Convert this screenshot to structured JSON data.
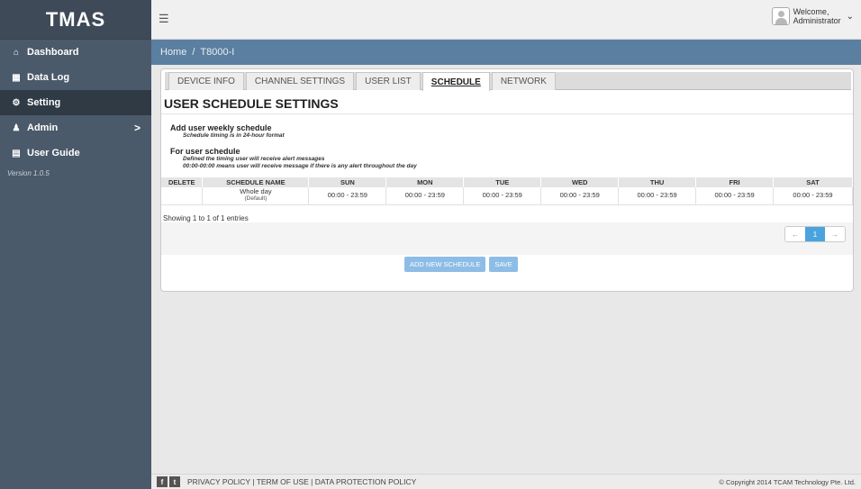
{
  "app": {
    "logo": "TMAS"
  },
  "sidebar": {
    "items": [
      {
        "label": "Dashboard",
        "icon": "home-icon"
      },
      {
        "label": "Data Log",
        "icon": "table-icon"
      },
      {
        "label": "Setting",
        "icon": "gear-icon",
        "active": true
      },
      {
        "label": "Admin",
        "icon": "user-icon",
        "chevron": ">"
      },
      {
        "label": "User Guide",
        "icon": "document-icon"
      }
    ],
    "version": "Version 1.0.5"
  },
  "header": {
    "welcome_line1": "Welcome,",
    "welcome_line2": "Administrator"
  },
  "breadcrumb": {
    "home": "Home",
    "separator": "/",
    "current": "T8000-I"
  },
  "tabs": [
    "DEVICE INFO",
    "CHANNEL SETTINGS",
    "USER LIST",
    "SCHEDULE",
    "NETWORK"
  ],
  "active_tab": "SCHEDULE",
  "page": {
    "title": "USER SCHEDULE SETTINGS",
    "add_heading": "Add user weekly schedule",
    "add_note": "Schedule timing is in 24-hour format",
    "for_heading": "For user schedule",
    "for_note1": "Defined the timing user will receive alert messages",
    "for_note2": "00:00-00:00 means user will receive message if there is any alert throughout the day"
  },
  "table": {
    "headers": [
      "DELETE",
      "SCHEDULE NAME",
      "SUN",
      "MON",
      "TUE",
      "WED",
      "THU",
      "FRI",
      "SAT"
    ],
    "rows": [
      {
        "delete": "",
        "name": "Whole day",
        "name_sub": "(Default)",
        "days": [
          "00:00 - 23:59",
          "00:00 - 23:59",
          "00:00 - 23:59",
          "00:00 - 23:59",
          "00:00 - 23:59",
          "00:00 - 23:59",
          "00:00 - 23:59"
        ]
      }
    ],
    "entries_text": "Showing 1 to 1 of 1 entries"
  },
  "pager": {
    "prev": "←",
    "current": "1",
    "next": "→"
  },
  "buttons": {
    "add": "ADD NEW SCHEDULE",
    "save": "SAVE"
  },
  "footer": {
    "social": [
      "f",
      "t"
    ],
    "links": "PRIVACY POLICY | TERM OF USE | DATA PROTECTION POLICY",
    "copyright": "© Copyright 2014 TCAM Technology Pte. Ltd."
  },
  "colors": {
    "sidebar": "#4b5a6a",
    "breadcrumb": "#5b7fa0",
    "accent": "#4aa3df",
    "button": "#8dbde6"
  }
}
